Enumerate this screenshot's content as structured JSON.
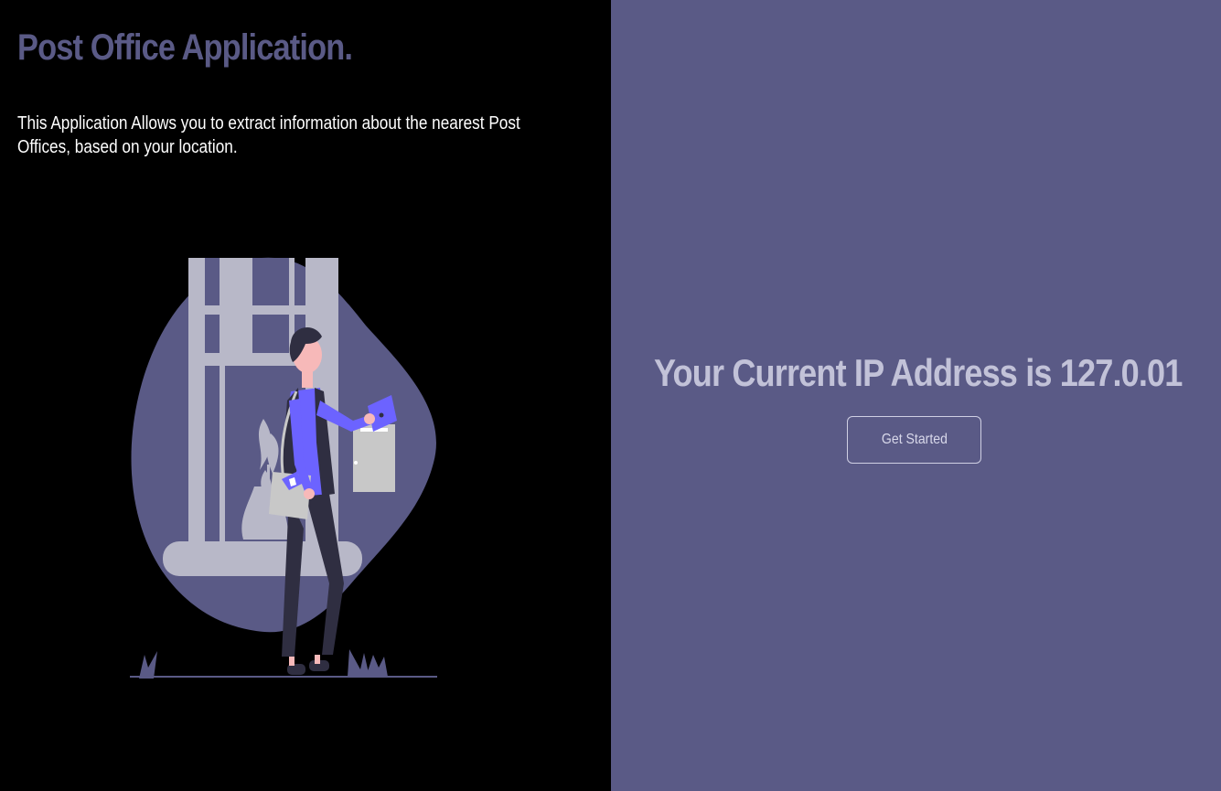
{
  "left_panel": {
    "title": "Post Office Application.",
    "description": "This Application Allows you to extract information about the nearest Post Offices, based on your location.",
    "illustration": "mailman-posting-letter-illustration"
  },
  "right_panel": {
    "ip_heading": "Your Current IP Address is 127.0.01",
    "get_started_label": "Get Started"
  },
  "colors": {
    "left_background": "#000000",
    "right_background": "#5a5a86",
    "accent": "#5a5a86",
    "figure_shirt": "#6c63ff",
    "heading_light": "#c2c2d8"
  }
}
